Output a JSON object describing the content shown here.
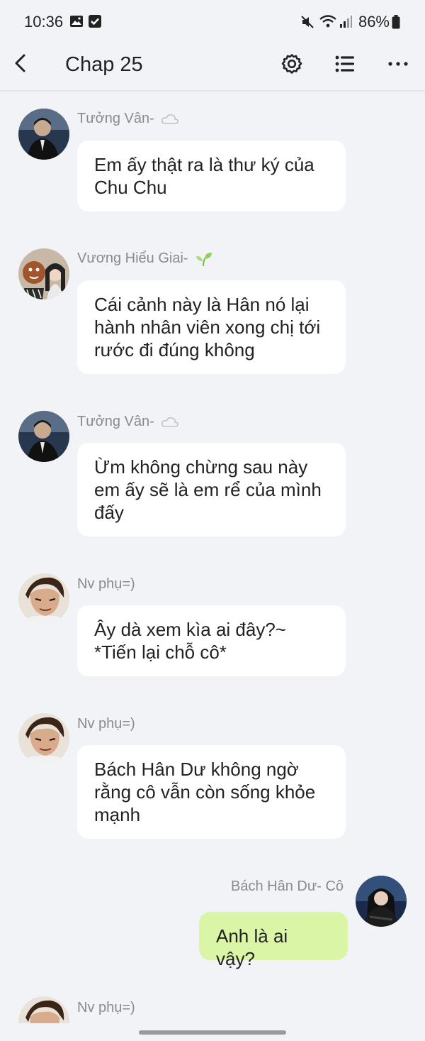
{
  "status": {
    "time": "10:36",
    "battery": "86%",
    "icons": [
      "image-icon",
      "check-box-icon",
      "mute-icon",
      "wifi-icon",
      "signal-icon",
      "battery-icon"
    ]
  },
  "header": {
    "title": "Chap 25",
    "icons": [
      "back-icon",
      "settings-icon",
      "list-icon",
      "more-icon"
    ]
  },
  "messages": [
    {
      "sender": "Tưởng Vân-",
      "badge": "cloud-icon",
      "text_lines": [
        "Em ấy thật ra là thư ký của",
        "Chu Chu"
      ],
      "side": "left"
    },
    {
      "sender": "Vương Hiểu Giai-",
      "badge": "sprout-icon",
      "text_lines": [
        "Cái cảnh này là Hân nó lại",
        "hành nhân viên xong chị tới",
        "rước đi đúng không"
      ],
      "side": "left"
    },
    {
      "sender": "Tưởng Vân-",
      "badge": "cloud-icon",
      "text_lines": [
        "Ừm không chừng sau này",
        "em ấy sẽ là em rể của mình",
        "đấy"
      ],
      "side": "left"
    },
    {
      "sender": "Nv phụ=)",
      "text_lines": [
        "Ây dà xem kìa ai đây?~",
        "*Tiến lại chỗ cô*"
      ],
      "side": "left"
    },
    {
      "sender": "Nv phụ=)",
      "text_lines": [
        "Bách Hân Dư không ngờ",
        "rằng cô vẫn còn sống khỏe",
        "mạnh"
      ],
      "side": "left"
    },
    {
      "sender": "Bách Hân Dư- Cô",
      "text_lines": [
        "Anh là ai vậy?"
      ],
      "side": "right"
    },
    {
      "sender": "Nv phụ=)",
      "text_lines": [],
      "side": "left"
    }
  ],
  "colors": {
    "background": "#f2f3f7",
    "bubble_other": "#ffffff",
    "bubble_mine": "#d9f5a5",
    "sender_text": "#8a8a8e"
  }
}
